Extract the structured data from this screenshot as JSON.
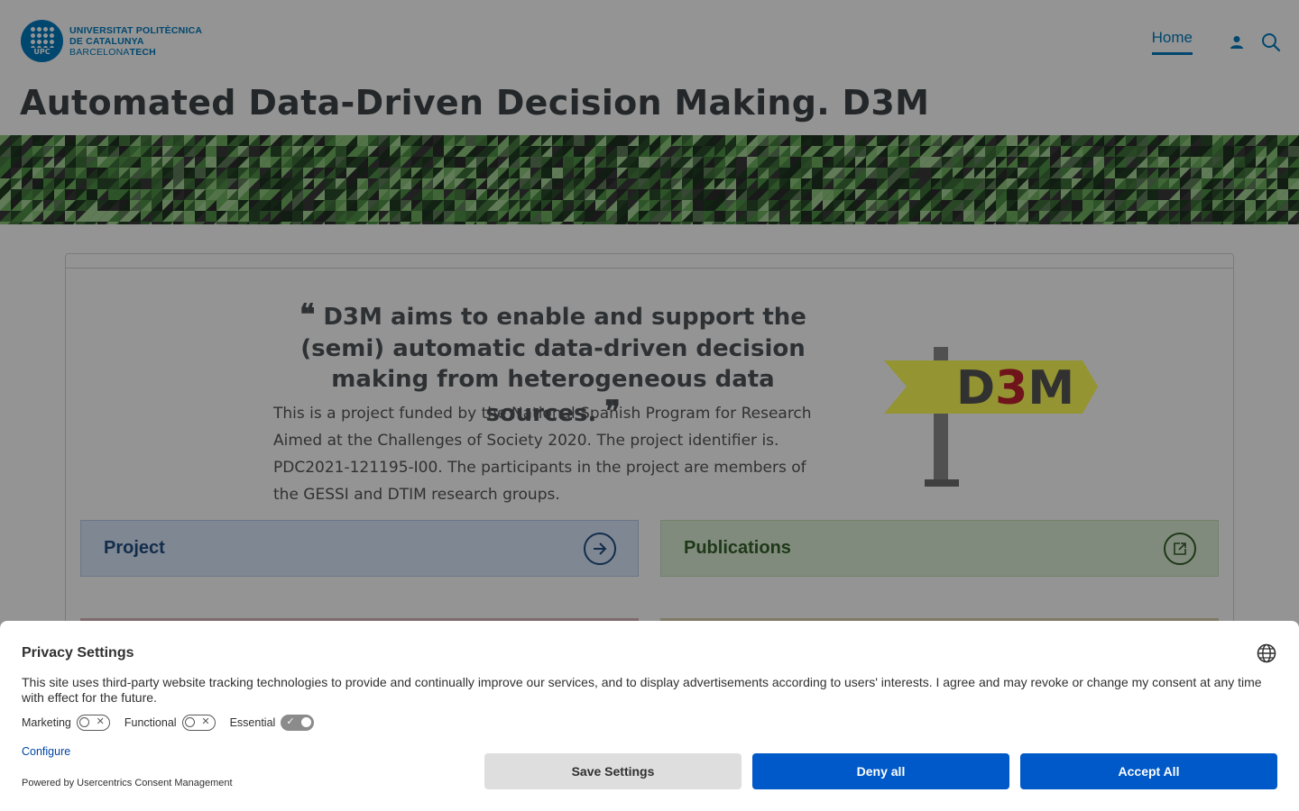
{
  "header": {
    "logo": {
      "mark_text": "UPC",
      "line1": "UNIVERSITAT POLITÈCNICA",
      "line2": "DE CATALUNYA",
      "line3_light": "BARCELONA",
      "line3_bold": "TECH"
    },
    "nav": {
      "home_label": "Home",
      "user_icon": "user-icon",
      "search_icon": "search-icon"
    }
  },
  "page": {
    "title": "Automated Data-Driven Decision Making. D3M"
  },
  "main": {
    "quote": "D3M aims to enable and support the (semi) automatic data-driven decision making from heterogeneous data sources.",
    "quote_open": "❝",
    "quote_close": "❞",
    "description": "This is a project funded by the National Spanish Program for Research Aimed at the Challenges of Society 2020. The project identifier is. PDC2021-121195-I00. The participants in the project are members of the GESSI and DTIM research groups.",
    "sign_logo": {
      "part1": "D",
      "part2": "3",
      "part3": "M"
    },
    "tiles": [
      {
        "label": "Project",
        "icon": "arrow-right-circle-icon"
      },
      {
        "label": "Publications",
        "icon": "external-link-icon"
      }
    ]
  },
  "privacy": {
    "title": "Privacy Settings",
    "text": "This site uses third-party website tracking technologies to provide and continually improve our services, and to display advertisements according to users' interests. I agree and may revoke or change my consent at any time with effect for the future.",
    "toggles": [
      {
        "label": "Marketing",
        "on": false
      },
      {
        "label": "Functional",
        "on": false
      },
      {
        "label": "Essential",
        "on": true
      }
    ],
    "configure_label": "Configure",
    "powered_by": "Powered by Usercentrics Consent Management",
    "buttons": {
      "save": "Save Settings",
      "deny": "Deny all",
      "accept": "Accept All"
    }
  },
  "colors": {
    "brand_blue": "#007bc0",
    "button_blue": "#0059c8",
    "sign_yellow": "#ffff58",
    "sign_red": "#c2232f"
  }
}
